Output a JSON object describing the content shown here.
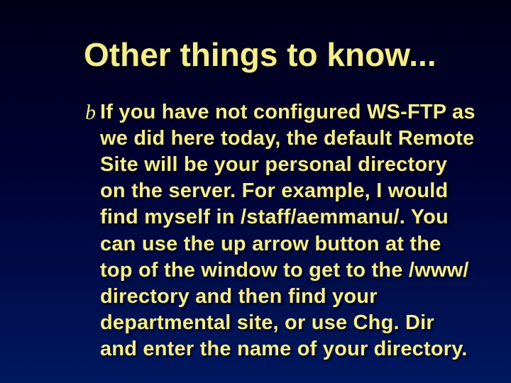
{
  "slide": {
    "title": "Other things to know...",
    "bullets": [
      {
        "marker": "b",
        "text": "If you have not configured WS-FTP as we did here today, the default Remote Site will be your personal directory on the server.  For example, I would find myself in /staff/aemmanu/.  You can use the up arrow button at the top of the window to get to the /www/ directory and then find your departmental site, or use Chg. Dir and enter the name of your directory."
      }
    ]
  }
}
